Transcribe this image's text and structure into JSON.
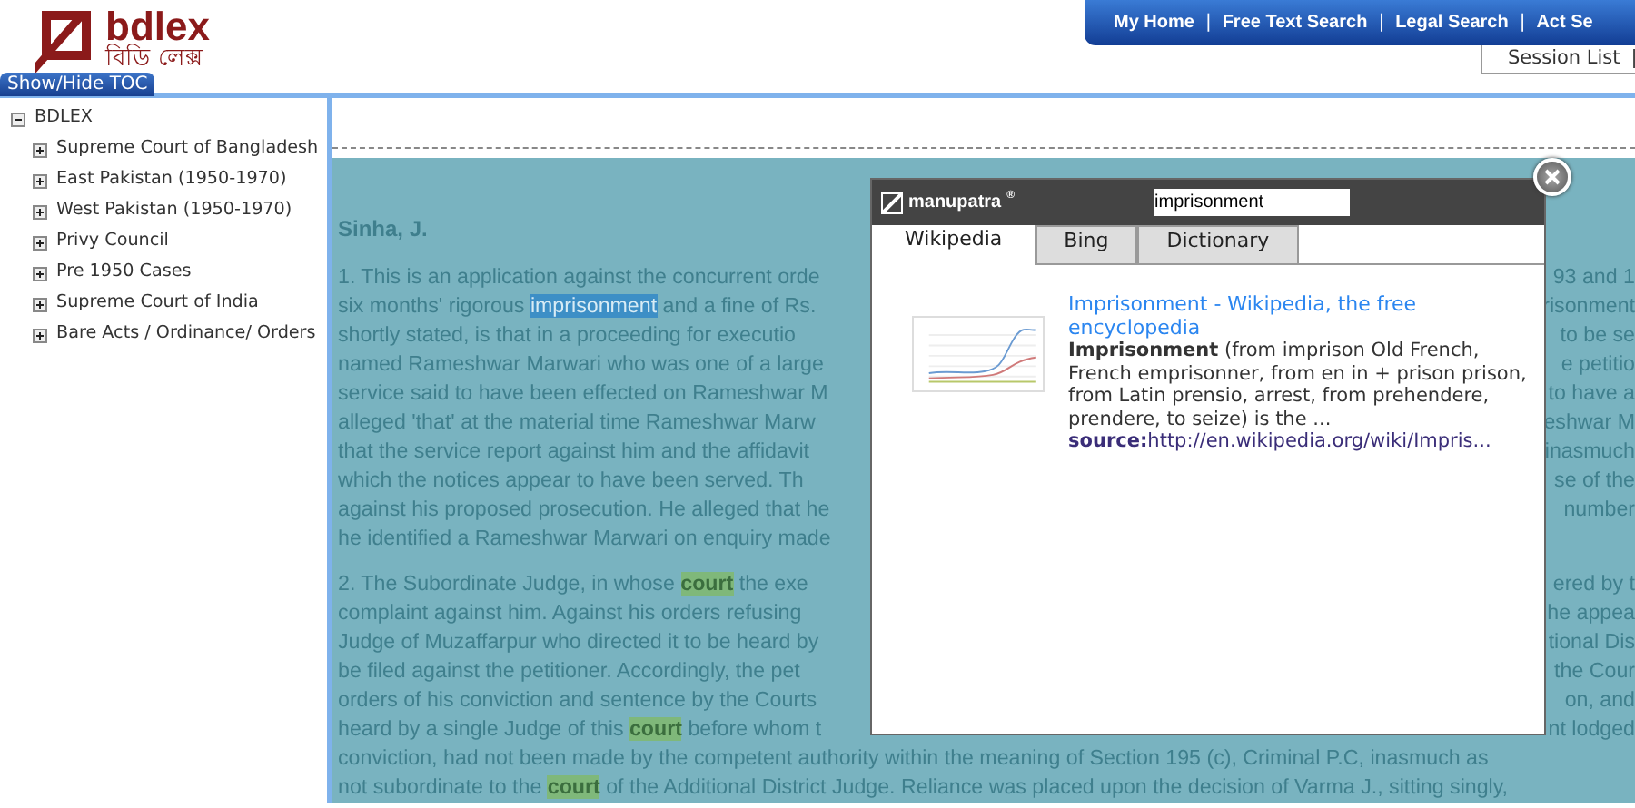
{
  "logo": {
    "name": "bdlex",
    "name_bengali": "বিডি লেক্স"
  },
  "toc_toggle": "Show/Hide TOC",
  "nav": {
    "items": [
      "My Home",
      "Free Text Search",
      "Legal Search",
      "Act Se"
    ],
    "separator": "|"
  },
  "session_tab": {
    "label": "Session List",
    "separator": "|"
  },
  "toc": {
    "label": "BDLEX",
    "expanded": true,
    "children": [
      {
        "label": "Supreme Court of Bangladesh",
        "expanded": false
      },
      {
        "label": "East Pakistan (1950-1970)",
        "expanded": false
      },
      {
        "label": "West Pakistan (1950-1970)",
        "expanded": false
      },
      {
        "label": "Privy Council",
        "expanded": false
      },
      {
        "label": "Pre 1950 Cases",
        "expanded": false
      },
      {
        "label": "Supreme Court of India",
        "expanded": false
      },
      {
        "label": "Bare Acts / Ordinance/ Orders",
        "expanded": false
      }
    ]
  },
  "document": {
    "judge": "Sinha, J.",
    "paragraphs": [
      {
        "lines": [
          {
            "parts": [
              {
                "text": "1. This is an application against the concurrent orde"
              }
            ],
            "right": "93 and 1"
          },
          {
            "parts": [
              {
                "text": "six months' rigorous "
              },
              {
                "text": "imprisonment",
                "kind": "selection"
              },
              {
                "text": " and a fine of Rs."
              }
            ],
            "right": "risonment"
          },
          {
            "parts": [
              {
                "text": "shortly stated, is that in a proceeding for executio"
              }
            ],
            "right": "to be se"
          },
          {
            "parts": [
              {
                "text": "named Rameshwar Marwari who was one of a large"
              }
            ],
            "right": "e petitio"
          },
          {
            "parts": [
              {
                "text": "service said to have been effected on Rameshwar M"
              }
            ],
            "right": "to have a"
          },
          {
            "parts": [
              {
                "text": "alleged 'that' at the material time Rameshwar Marw"
              }
            ],
            "right": "eshwar M"
          },
          {
            "parts": [
              {
                "text": "that the service report against him and the affidavit"
              }
            ],
            "right": "inasmuch"
          },
          {
            "parts": [
              {
                "text": "which the notices appear to have been served. Th"
              }
            ],
            "right": "se of the"
          },
          {
            "parts": [
              {
                "text": "against his proposed prosecution. He alleged that he"
              }
            ],
            "right": "number"
          },
          {
            "parts": [
              {
                "text": "he identified a Rameshwar Marwari on enquiry made"
              }
            ]
          }
        ]
      },
      {
        "lines": [
          {
            "parts": [
              {
                "text": "2. The Subordinate Judge, in whose "
              },
              {
                "text": "court",
                "kind": "match"
              },
              {
                "text": " the exe"
              }
            ],
            "right": "ered by t"
          },
          {
            "parts": [
              {
                "text": "complaint against him. Against his orders refusing"
              }
            ],
            "right": "he appea"
          },
          {
            "parts": [
              {
                "text": "Judge of Muzaffarpur who directed it to be heard by"
              }
            ],
            "right": "tional Dis"
          },
          {
            "parts": [
              {
                "text": "be filed against the petitioner. Accordingly, the pet"
              }
            ],
            "right": "the Cour"
          },
          {
            "parts": [
              {
                "text": "orders of his conviction and sentence by the Courts"
              }
            ],
            "right": "on, and"
          },
          {
            "parts": [
              {
                "text": "heard by a single Judge of this "
              },
              {
                "text": "court",
                "kind": "match"
              },
              {
                "text": " before whom t"
              }
            ],
            "right": "nt lodged"
          },
          {
            "parts": [
              {
                "text": "conviction, had not been made by the competent authority within the meaning of Section 195 (c), Criminal P.C, inasmuch as"
              }
            ]
          },
          {
            "parts": [
              {
                "text": "not subordinate to the "
              },
              {
                "text": "court",
                "kind": "match"
              },
              {
                "text": " of the Additional District Judge. Reliance was placed upon the decision of Varma J., sitting singly,"
              }
            ]
          }
        ]
      }
    ]
  },
  "popup": {
    "brand": "manupatra",
    "brand_mark": "®",
    "search_value": "imprisonment",
    "tabs": [
      {
        "label": "Wikipedia",
        "selected": true
      },
      {
        "label": "Bing",
        "selected": false
      },
      {
        "label": "Dictionary",
        "selected": false
      }
    ],
    "result": {
      "title": "Imprisonment - Wikipedia, the free encyclopedia",
      "snippet": "**Imprisonment** (from imprison Old French, French emprisonner, from en in + prison prison, from Latin prensio, arrest, from prehendere, prendere, to seize) is the ...",
      "source": "**source:**http://en.wikipedia.org/wiki/Impris..."
    }
  }
}
